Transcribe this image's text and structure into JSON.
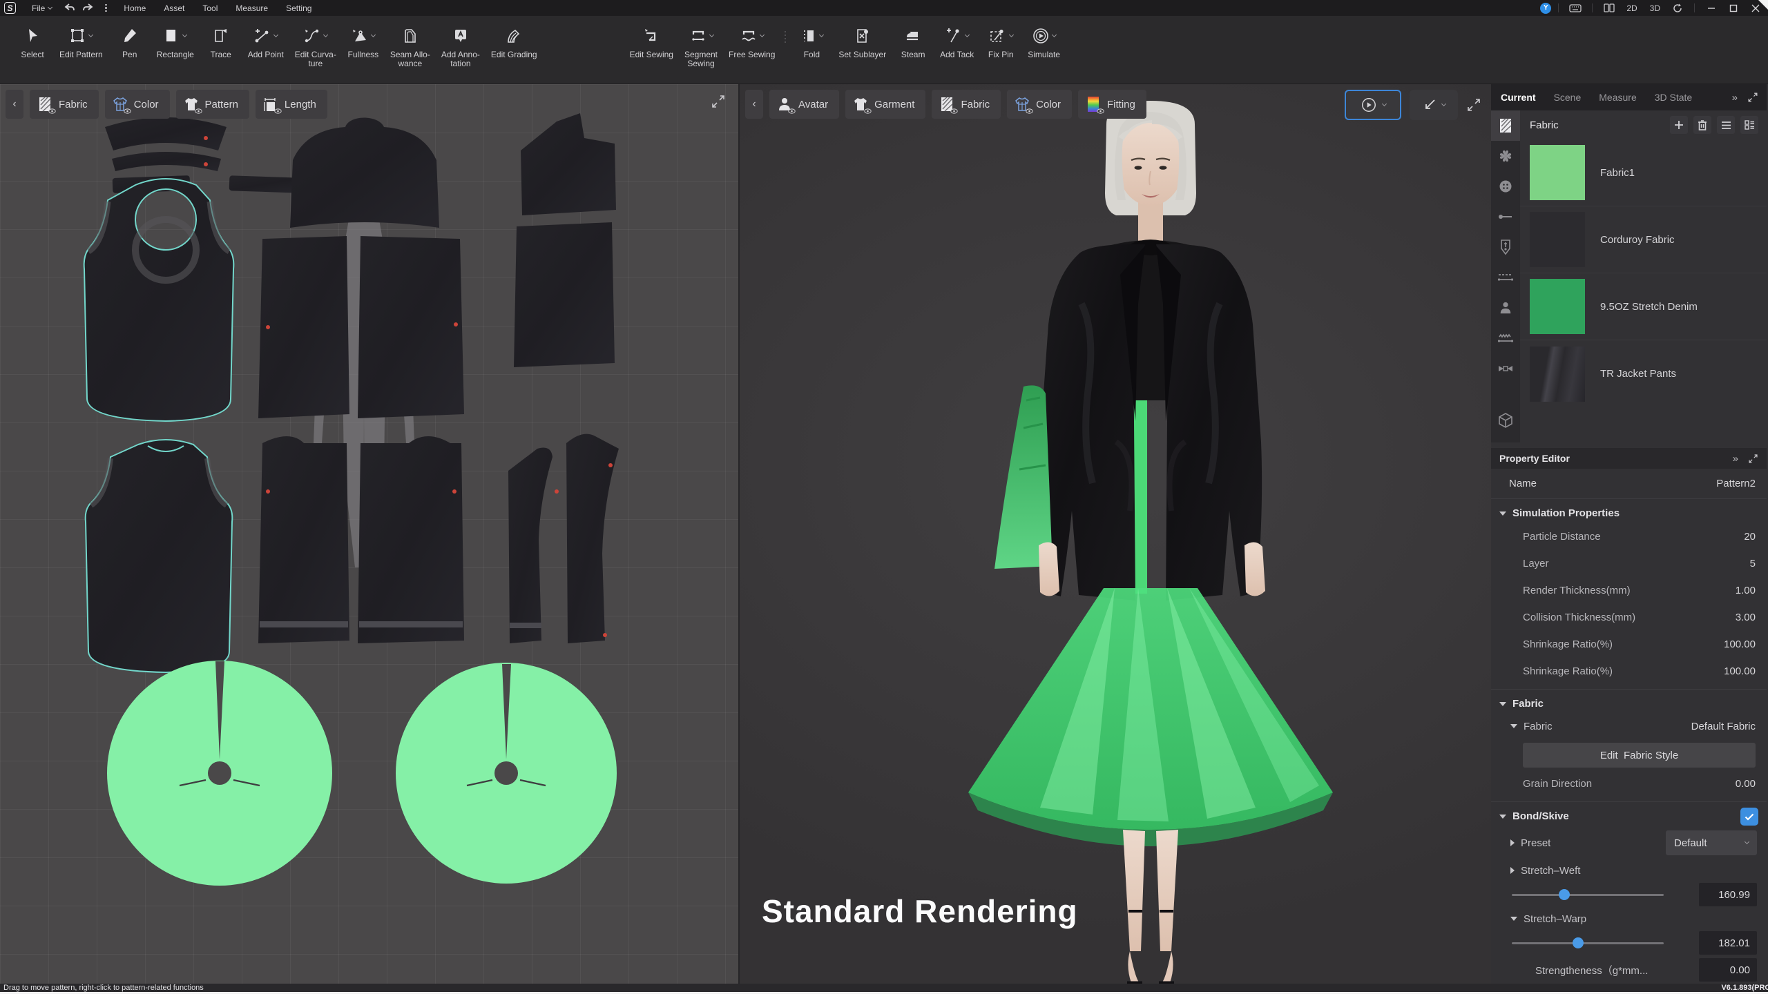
{
  "app": {
    "logo": "S",
    "menu": {
      "file": "File",
      "items": [
        "Home",
        "Asset",
        "Tool",
        "Measure",
        "Setting"
      ]
    },
    "titlebar": {
      "user_initial": "Y",
      "mode_2d": "2D",
      "mode_3d": "3D"
    }
  },
  "toolbar": {
    "buttons": [
      {
        "label": "Select"
      },
      {
        "label": "Edit Pattern"
      },
      {
        "label": "Pen"
      },
      {
        "label": "Rectangle"
      },
      {
        "label": "Trace"
      },
      {
        "label": "Add Point"
      },
      {
        "label": "Edit Curva-\nture"
      },
      {
        "label": "Fullness"
      },
      {
        "label": "Seam Allo-\nwance"
      },
      {
        "label": "Add Anno-\ntation"
      },
      {
        "label": "Edit Grading"
      },
      {
        "label": "Edit Sewing"
      },
      {
        "label": "Segment\nSewing"
      },
      {
        "label": "Free Sewing"
      },
      {
        "label": "Fold"
      },
      {
        "label": "Set Sublayer"
      },
      {
        "label": "Steam"
      },
      {
        "label": "Add Tack"
      },
      {
        "label": "Fix Pin"
      },
      {
        "label": "Simulate"
      }
    ]
  },
  "panel2d": {
    "tabs": [
      {
        "label": "Fabric"
      },
      {
        "label": "Color"
      },
      {
        "label": "Pattern"
      },
      {
        "label": "Length"
      }
    ]
  },
  "panel3d": {
    "tabs": [
      {
        "label": "Avatar"
      },
      {
        "label": "Garment"
      },
      {
        "label": "Fabric"
      },
      {
        "label": "Color"
      },
      {
        "label": "Fitting"
      }
    ],
    "overlay_text": "Standard Rendering"
  },
  "right_panel": {
    "tabs": [
      "Current",
      "Scene",
      "Measure",
      "3D State"
    ],
    "active_tab": "Current",
    "fabric_list": {
      "title": "Fabric",
      "items": [
        {
          "name": "Fabric1",
          "color": "#7ed385"
        },
        {
          "name": "Corduroy Fabric",
          "color": "#2c2b2f"
        },
        {
          "name": "9.5OZ Stretch Denim",
          "color": "#2fa35c"
        },
        {
          "name": "TR Jacket Pants",
          "color": "linear-gradient(100deg,#2a292d 30%,#44434a 38%,#2a292d 55%,#38373d 75%,#26252a 100%)"
        }
      ]
    },
    "property_editor": {
      "title": "Property Editor",
      "name_label": "Name",
      "name_value": "Pattern2",
      "sim": {
        "title": "Simulation Properties",
        "rows": [
          {
            "label": "Particle Distance",
            "value": "20"
          },
          {
            "label": "Layer",
            "value": "5"
          },
          {
            "label": "Render Thickness(mm)",
            "value": "1.00"
          },
          {
            "label": "Collision Thickness(mm)",
            "value": "3.00"
          },
          {
            "label": "Shrinkage Ratio(%)",
            "value": "100.00"
          },
          {
            "label": "Shrinkage Ratio(%)",
            "value": "100.00"
          }
        ]
      },
      "fabric": {
        "title": "Fabric",
        "sub_label": "Fabric",
        "sub_value": "Default Fabric",
        "edit_button": "Edit  Fabric Style",
        "grain_label": "Grain Direction",
        "grain_value": "0.00"
      },
      "bond": {
        "title": "Bond/Skive",
        "preset_label": "Preset",
        "preset_value": "Default",
        "weft_label": "Stretch–Weft",
        "weft_value": "160.99",
        "warp_label": "Stretch–Warp",
        "warp_value": "182.01",
        "strength_label": "Strengtheness（g*mm...",
        "strength_value": "0.00"
      }
    },
    "version": "V6.1.893(PRO"
  },
  "statusbar": {
    "hint": "Drag to move pattern, right-click to pattern-related functions"
  },
  "colors": {
    "accent_blue": "#3d86d8",
    "pattern_green": "#85f0a7",
    "skirt_green": "#3ed573",
    "fabric1_green": "#7ed385",
    "denim_green": "#2fa35c"
  }
}
